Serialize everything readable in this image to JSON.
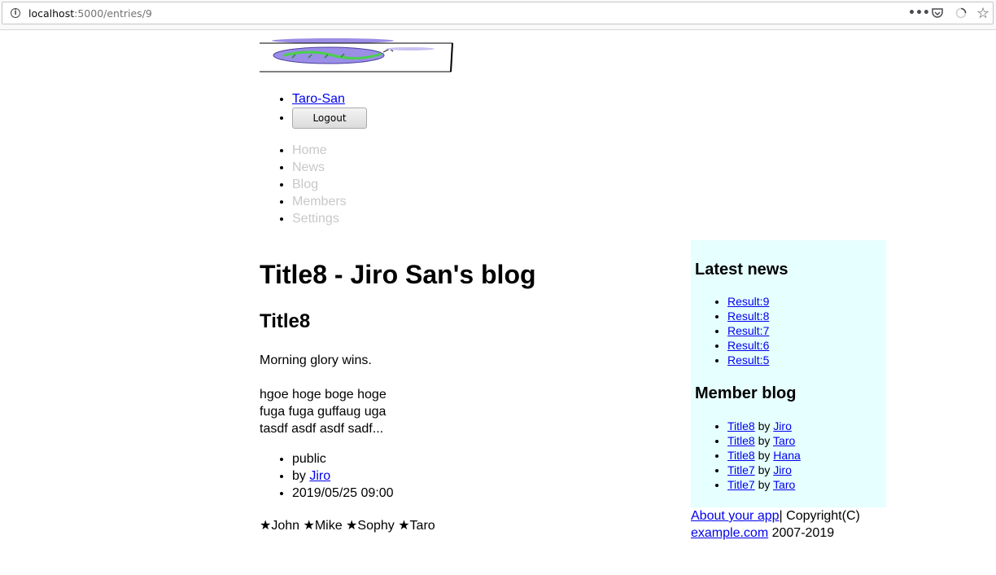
{
  "browser": {
    "url_host": "localhost",
    "url_path": ":5000/entries/9",
    "icons": [
      "info-icon",
      "more-icon",
      "pocket-icon",
      "spinner-icon",
      "star-icon"
    ]
  },
  "user_nav": {
    "user_name": "Taro-San",
    "logout_label": "Logout"
  },
  "main_nav": {
    "items": [
      "Home",
      "News",
      "Blog",
      "Members",
      "Settings"
    ]
  },
  "content": {
    "page_title": "Title8 - Jiro San's blog",
    "entry_title": "Title8",
    "summary": "Morning glory wins.",
    "body_lines": [
      "hgoe hoge boge hoge",
      "fuga fuga guffaug uga",
      "tasdf asdf asdf sadf..."
    ],
    "meta": {
      "visibility": "public",
      "by_prefix": "by ",
      "author": "Jiro",
      "date": "2019/05/25 09:00"
    },
    "likes": "★John ★Mike ★Sophy ★Taro"
  },
  "sidebar": {
    "news_heading": "Latest news",
    "news_items": [
      "Result:9",
      "Result:8",
      "Result:7",
      "Result:6",
      "Result:5"
    ],
    "blog_heading": "Member blog",
    "by_word": " by ",
    "blog_items": [
      {
        "title": "Title8",
        "author": "Jiro"
      },
      {
        "title": "Title8",
        "author": "Taro"
      },
      {
        "title": "Title8",
        "author": "Hana"
      },
      {
        "title": "Title7",
        "author": "Jiro"
      },
      {
        "title": "Title7",
        "author": "Taro"
      }
    ]
  },
  "footer": {
    "about_link": "About your app",
    "copyright": "| Copyright(C)",
    "site_link": "example.com",
    "years": " 2007-2019"
  },
  "colors": {
    "sidebar_bg": "#e6ffff",
    "link": "#0000ee",
    "nav_disabled": "#c8c8c8"
  }
}
